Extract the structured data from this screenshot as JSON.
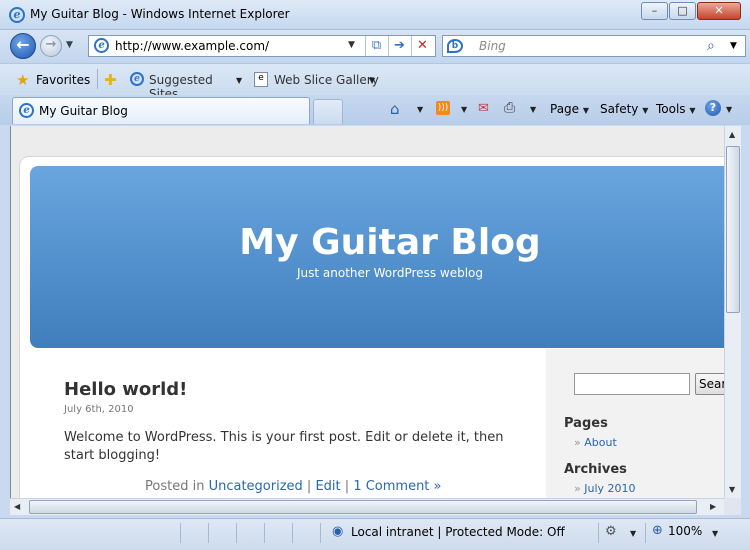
{
  "window": {
    "title": "My Guitar Blog - Windows Internet Explorer",
    "minimize": "–",
    "maximize": "□",
    "close": "✕"
  },
  "nav": {
    "back_icon": "arrow-left-icon",
    "forward_icon": "arrow-right-icon",
    "url": "http://www.example.com/",
    "search_placeholder": "Bing"
  },
  "favorites_bar": {
    "favorites_label": "Favorites",
    "suggested_sites": "Suggested Sites",
    "web_slice_gallery": "Web Slice Gallery"
  },
  "tabs": [
    {
      "label": "My Guitar Blog",
      "active": true
    }
  ],
  "command_bar": {
    "page": "Page",
    "safety": "Safety",
    "tools": "Tools",
    "help": "?"
  },
  "blog": {
    "title": "My Guitar Blog",
    "description": "Just another WordPress weblog",
    "post": {
      "title": "Hello world!",
      "date": "July 6th, 2010",
      "body": "Welcome to WordPress. This is your first post. Edit or delete it, then start blogging!",
      "meta_prefix": "Posted in",
      "category": "Uncategorized",
      "sep1": "|",
      "edit": "Edit",
      "sep2": "|",
      "comments": "1 Comment »"
    },
    "sidebar": {
      "search_button": "Search",
      "pages_heading": "Pages",
      "pages": [
        "About"
      ],
      "archives_heading": "Archives",
      "archives": [
        "July 2010"
      ]
    }
  },
  "status_bar": {
    "zone": "Local intranet | Protected Mode: Off",
    "zoom": "100%"
  },
  "colors": {
    "header_top": "#69a6e0",
    "header_bottom": "#3f7dbc",
    "link": "#2867b2"
  }
}
